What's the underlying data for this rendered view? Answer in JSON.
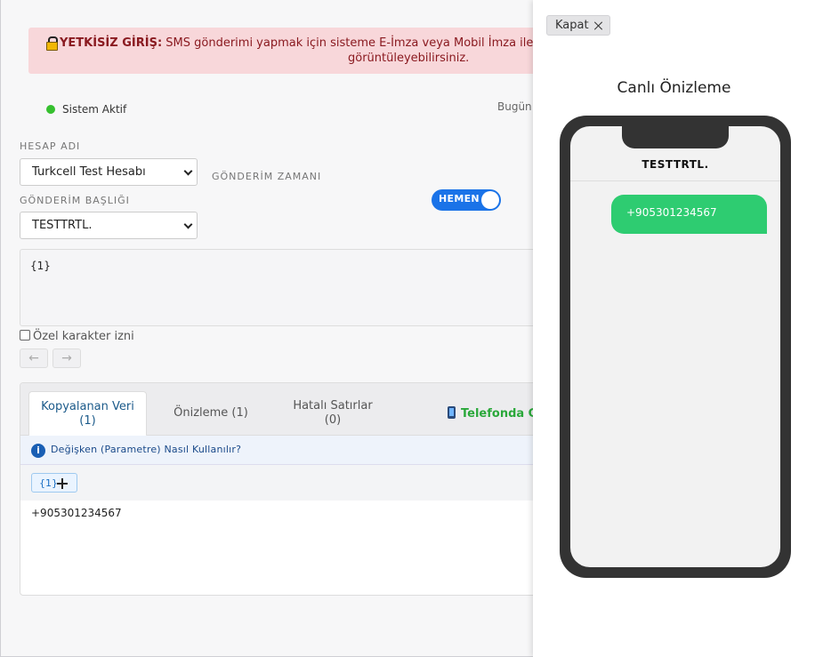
{
  "alert": {
    "bold": "YETKİSİZ GİRİŞ:",
    "line1": " SMS gönderimi yapmak için sisteme E-İmza veya Mobil İmza ile g",
    "line2": "görüntüleyebilirsiniz."
  },
  "status": {
    "label": "Sistem Aktif",
    "color": "#36c02f",
    "today": "Bugün:"
  },
  "form": {
    "account_label": "HESAP ADI",
    "account_value": "Turkcell Test Hesabı",
    "header_label": "GÖNDERİM BAŞLIĞI",
    "header_value": "TESTTRTL.",
    "time_label": "GÖNDERİM ZAMANI",
    "time_toggle": "HEMEN",
    "message": "{1}",
    "special_char": "Özel karakter izni",
    "undo": "←",
    "redo": "→"
  },
  "tabs": [
    {
      "label": "Kopyalanan Veri",
      "count": "(1)"
    },
    {
      "label": "Önizleme (1)"
    },
    {
      "label": "Hatalı Satırlar",
      "count": "(0)"
    },
    {
      "label": "Telefonda Gö"
    }
  ],
  "info": {
    "text": "Değişken (Parametre) Nasıl Kullanılır?",
    "icon": "i"
  },
  "param_chip": "{1}",
  "data_rows": [
    "+905301234567"
  ],
  "preview": {
    "close_label": "Kapat",
    "title": "Canlı Önizleme",
    "sender": "TESTTRTL.",
    "message": "+905301234567",
    "bubble_color": "#2ecc71"
  },
  "colors": {
    "accent": "#1a73e8",
    "alert_bg": "#f8d7da",
    "alert_text": "#8a1a20"
  }
}
